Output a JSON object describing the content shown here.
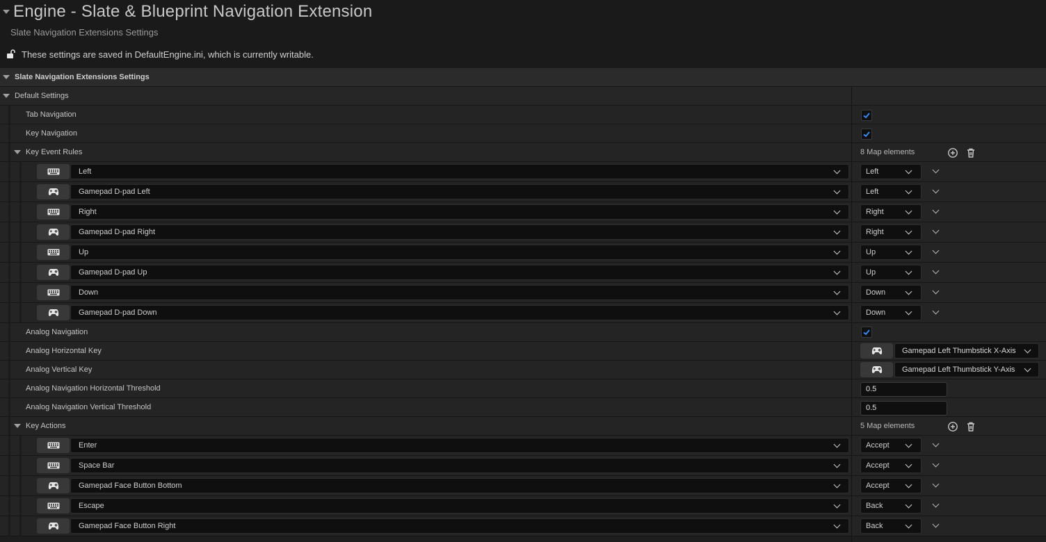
{
  "header": {
    "title": "Engine - Slate & Blueprint Navigation Extension",
    "subtitle": "Slate Navigation Extensions Settings",
    "notice": "These settings are saved in DefaultEngine.ini, which is currently writable."
  },
  "section": {
    "label": "Slate Navigation Extensions Settings"
  },
  "default_settings": {
    "label": "Default Settings"
  },
  "tab_navigation": {
    "label": "Tab Navigation",
    "checked": true
  },
  "key_navigation": {
    "label": "Key Navigation",
    "checked": true
  },
  "key_event_rules": {
    "label": "Key Event Rules",
    "count": "8 Map elements",
    "items": [
      {
        "device": "keyboard-icon",
        "key": "Left",
        "value": "Left"
      },
      {
        "device": "gamepad-icon",
        "key": "Gamepad D-pad Left",
        "value": "Left"
      },
      {
        "device": "keyboard-icon",
        "key": "Right",
        "value": "Right"
      },
      {
        "device": "gamepad-icon",
        "key": "Gamepad D-pad Right",
        "value": "Right"
      },
      {
        "device": "keyboard-icon",
        "key": "Up",
        "value": "Up"
      },
      {
        "device": "gamepad-icon",
        "key": "Gamepad D-pad Up",
        "value": "Up"
      },
      {
        "device": "keyboard-icon",
        "key": "Down",
        "value": "Down"
      },
      {
        "device": "gamepad-icon",
        "key": "Gamepad D-pad Down",
        "value": "Down"
      }
    ]
  },
  "analog_navigation": {
    "label": "Analog Navigation",
    "checked": true
  },
  "analog_horizontal_key": {
    "label": "Analog Horizontal Key",
    "device": "gamepad-icon",
    "value": "Gamepad Left Thumbstick X-Axis"
  },
  "analog_vertical_key": {
    "label": "Analog Vertical Key",
    "device": "gamepad-icon",
    "value": "Gamepad Left Thumbstick Y-Axis"
  },
  "analog_h_threshold": {
    "label": "Analog Navigation Horizontal Threshold",
    "value": "0.5"
  },
  "analog_v_threshold": {
    "label": "Analog Navigation Vertical Threshold",
    "value": "0.5"
  },
  "key_actions": {
    "label": "Key Actions",
    "count": "5 Map elements",
    "items": [
      {
        "device": "keyboard-icon",
        "key": "Enter",
        "value": "Accept"
      },
      {
        "device": "keyboard-icon",
        "key": "Space Bar",
        "value": "Accept"
      },
      {
        "device": "gamepad-icon",
        "key": "Gamepad Face Button Bottom",
        "value": "Accept"
      },
      {
        "device": "keyboard-icon",
        "key": "Escape",
        "value": "Back"
      },
      {
        "device": "gamepad-icon",
        "key": "Gamepad Face Button Right",
        "value": "Back"
      }
    ]
  },
  "colors": {
    "background": "#1a1a1a",
    "row": "#242424",
    "category_row": "#2b2b2b",
    "checkbox_check": "#2f8bff",
    "combo_bg": "#0f0f0f"
  }
}
